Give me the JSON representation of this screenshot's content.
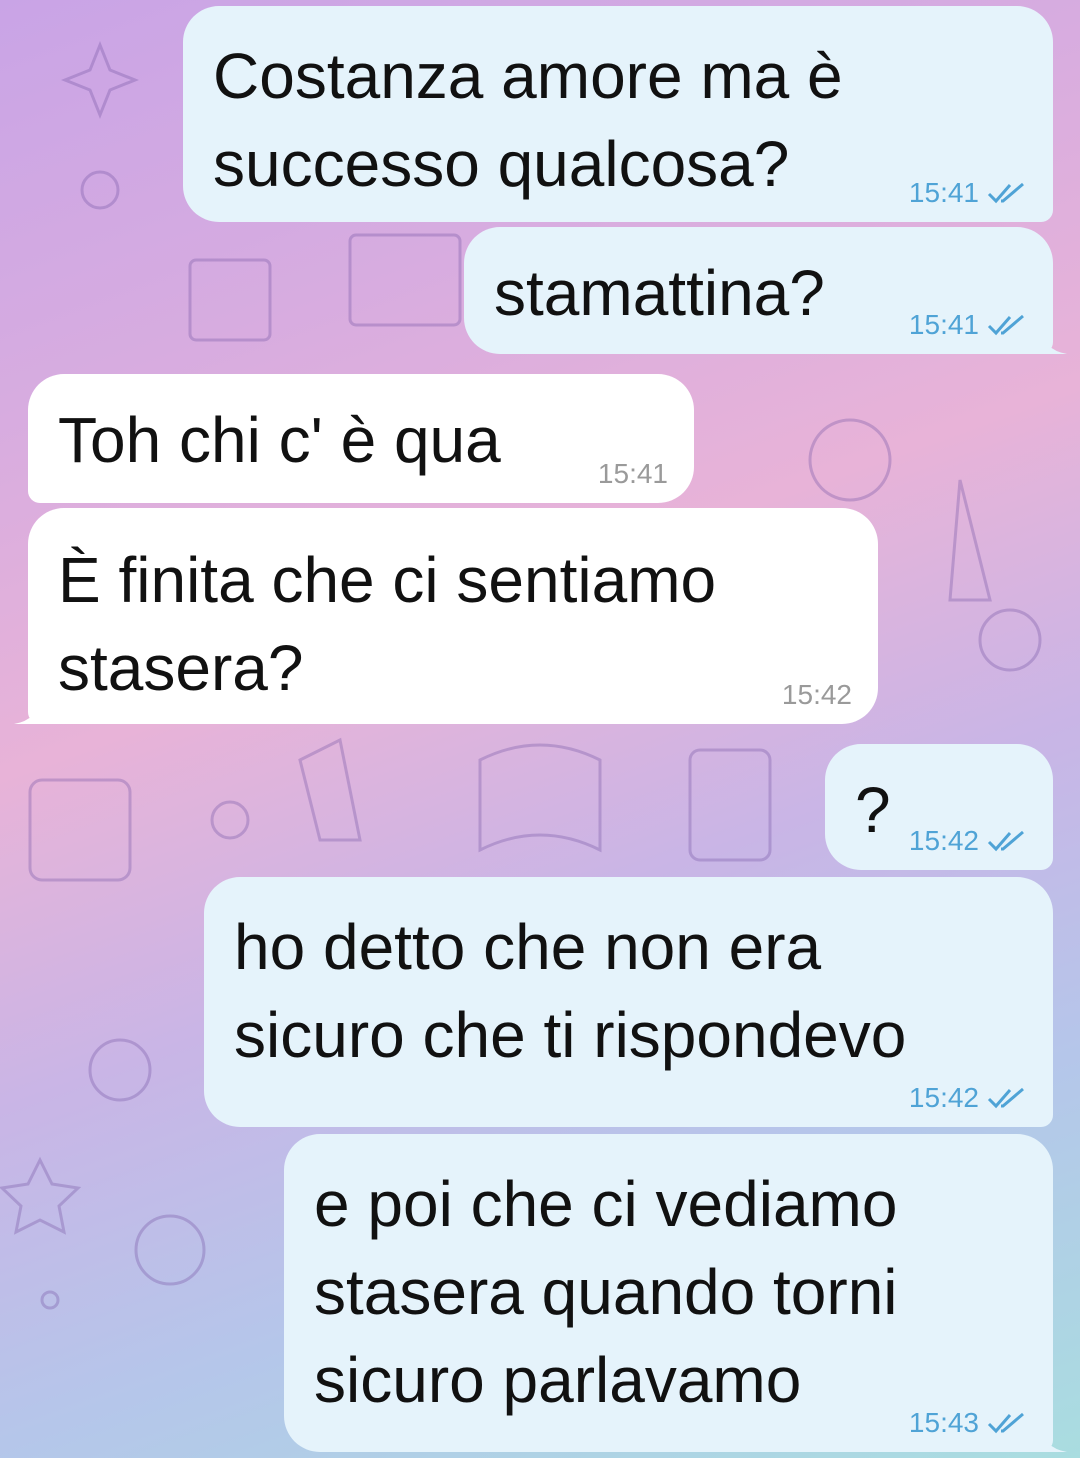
{
  "messages": [
    {
      "direction": "out",
      "text": "Costanza amore ma è\nsuccesso qualcosa?",
      "time": "15:41",
      "status": "double-check"
    },
    {
      "direction": "out",
      "text": "stamattina?",
      "time": "15:41",
      "status": "double-check"
    },
    {
      "direction": "in",
      "text": "Toh chi c' è qua",
      "time": "15:41"
    },
    {
      "direction": "in",
      "text": "È finita che ci sentiamo\nstasera?",
      "time": "15:42"
    },
    {
      "direction": "out",
      "text": "?",
      "time": "15:42",
      "status": "double-check"
    },
    {
      "direction": "out",
      "text": "ho detto che non era\nsicuro che ti rispondevo",
      "time": "15:42",
      "status": "double-check"
    },
    {
      "direction": "out",
      "text": "e poi che ci vediamo\nstasera quando torni\nsicuro parlavamo",
      "time": "15:43",
      "status": "double-check"
    }
  ],
  "colors": {
    "outgoing_bubble": "#e5f3fb",
    "incoming_bubble": "#ffffff",
    "read_ticks": "#4fa3d6"
  }
}
